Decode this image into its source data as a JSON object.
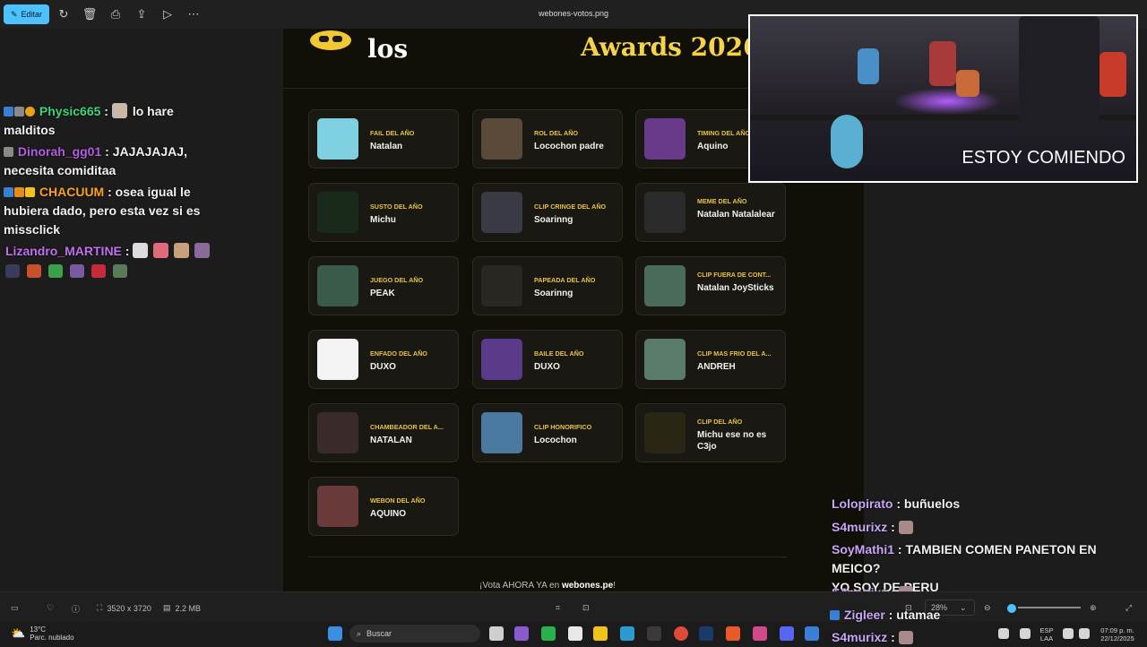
{
  "toolbar": {
    "edit_label": "Editar",
    "file_title": "webones-votos.png",
    "icons": [
      "edit-icon",
      "rotate-icon",
      "delete-icon",
      "print-icon",
      "share-icon",
      "slideshow-icon",
      "more-icon"
    ]
  },
  "awards": {
    "header_left": "los",
    "header_right": "Awards 2026",
    "cards": [
      {
        "category": "FAIL DEL AÑO",
        "winner": "Natalan",
        "thumb_color": "#7fd0e0"
      },
      {
        "category": "ROL DEL AÑO",
        "winner": "Locochon padre",
        "thumb_color": "#5a4a3a"
      },
      {
        "category": "TIMING DEL AÑO",
        "winner": "Aquino",
        "thumb_color": "#6a3a8a"
      },
      {
        "category": "SUSTO DEL AÑO",
        "winner": "Michu",
        "thumb_color": "#1a2a1a"
      },
      {
        "category": "CLIP CRINGE DEL AÑO",
        "winner": "Soarinng",
        "thumb_color": "#3a3a44"
      },
      {
        "category": "MEME DEL AÑO",
        "winner": "Natalan Natalalear",
        "thumb_color": "#2a2a2a"
      },
      {
        "category": "JUEGO DEL AÑO",
        "winner": "PEAK",
        "thumb_color": "#3a5a4a"
      },
      {
        "category": "PAPEADA DEL AÑO",
        "winner": "Soarinng",
        "thumb_color": "#2a2622"
      },
      {
        "category": "CLIP FUERA DE CONT...",
        "winner": "Natalan JoySticks",
        "thumb_color": "#4a6a5a"
      },
      {
        "category": "ENFADO DEL AÑO",
        "winner": "DUXO",
        "thumb_color": "#f4f4f4"
      },
      {
        "category": "BAILE DEL AÑO",
        "winner": "DUXO",
        "thumb_color": "#5a3a8a"
      },
      {
        "category": "CLIP MAS FRIO DEL A...",
        "winner": "ANDREH",
        "thumb_color": "#5a7a6a"
      },
      {
        "category": "CHAMBEADOR DEL A...",
        "winner": "NATALAN",
        "thumb_color": "#3a2a2a"
      },
      {
        "category": "CLIP HONORIFICO",
        "winner": "Locochon",
        "thumb_color": "#4a7aa0"
      },
      {
        "category": "CLIP DEL AÑO",
        "winner": "Michu ese no es C3jo",
        "thumb_color": "#2a2616"
      },
      {
        "category": "WEBON DEL AÑO",
        "winner": "AQUINO",
        "thumb_color": "#6a3a3a"
      }
    ],
    "footer_prefix": "¡Vota AHORA YA en ",
    "footer_site": "webones.pe",
    "footer_suffix": "!"
  },
  "webcam": {
    "caption": "ESTOY COMIENDO"
  },
  "chat_left": [
    {
      "user": "Physic665",
      "user_color": "#3fd47a",
      "sep": " : ",
      "text1": "lo hare",
      "text2": "malditos"
    },
    {
      "user": "Dinorah_gg01",
      "user_color": "#b35ee0",
      "sep": " : ",
      "text1": "JAJAJAJAJ,",
      "text2": "necesita comiditaa"
    },
    {
      "user": "CHACUUM",
      "user_color": "#ffa21a",
      "sep": " : ",
      "text1": "osea igual le",
      "text2": "hubiera dado, pero esta vez si es",
      "text3": "missclick"
    },
    {
      "user": "Lizandro_MARTINE",
      "user_color": "#c070f0",
      "sep": " : "
    }
  ],
  "chat_right": [
    {
      "user": "Lolopirato",
      "sep": " : ",
      "text": "buñuelos"
    },
    {
      "user": "S4murixz",
      "sep": " : ",
      "text": ""
    },
    {
      "user": "SoyMathi1",
      "sep": " : ",
      "text": "TAMBIEN COMEN PANETON EN MEICO?",
      "text2": "YO SOY DE PERU"
    },
    {
      "user": "S4murixz",
      "sep": " : ",
      "text": ""
    },
    {
      "user": "Zigleer",
      "sep": " : ",
      "text": "utamae"
    },
    {
      "user": "S4murixz",
      "sep": " : ",
      "text": ""
    }
  ],
  "statusbar": {
    "dimensions": "3520 x 3720",
    "filesize": "2.2 MB",
    "zoom": "28%",
    "zoom_fraction": 0.06
  },
  "taskbar": {
    "temperature": "13°C",
    "weather_text": "Parc. nublado",
    "search_placeholder": "Buscar",
    "lang1": "ESP",
    "lang2": "LAA",
    "time": "07:09 p. m.",
    "date": "22/12/2025"
  }
}
